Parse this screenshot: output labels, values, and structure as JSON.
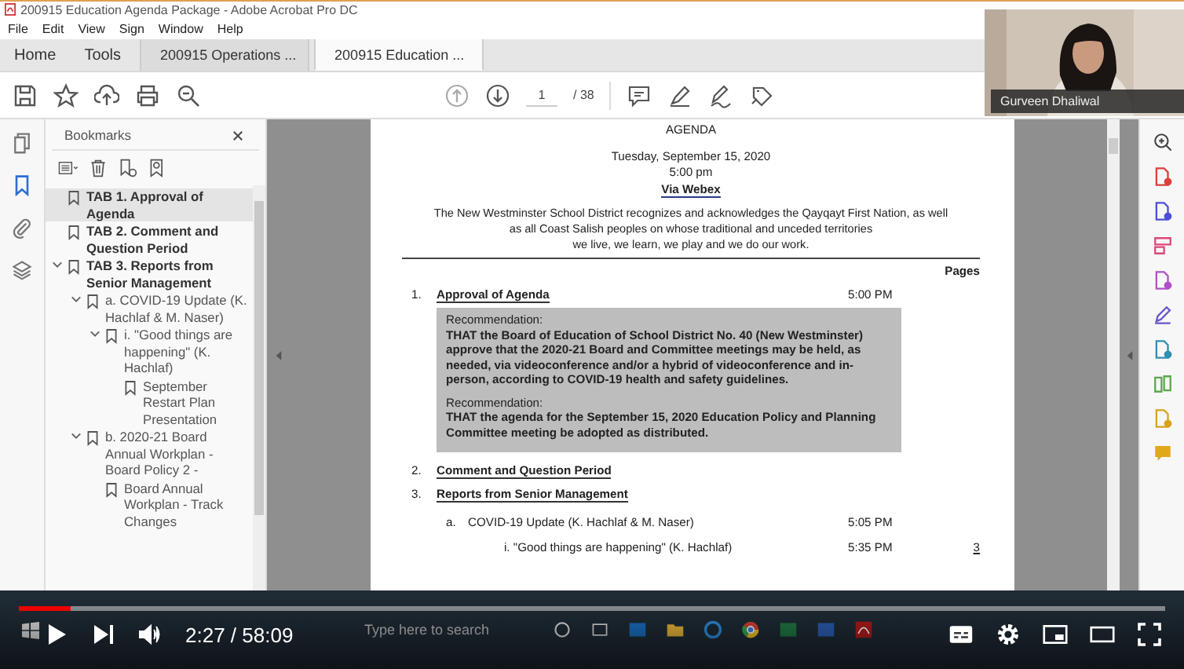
{
  "window": {
    "title": "200915 Education Agenda Package - Adobe Acrobat Pro DC"
  },
  "menu": [
    "File",
    "Edit",
    "View",
    "Sign",
    "Window",
    "Help"
  ],
  "nav_tabs": [
    {
      "label": "Home",
      "selected": false
    },
    {
      "label": "Tools",
      "selected": false
    }
  ],
  "doc_tabs": [
    {
      "label": "200915 Operations ...",
      "selected": false
    },
    {
      "label": "200915 Education ...",
      "selected": true
    }
  ],
  "page_nav": {
    "current": "1",
    "total": "/ 38"
  },
  "left_rail": [
    {
      "kind": "pages",
      "selected": false
    },
    {
      "kind": "bookmarks",
      "selected": true
    },
    {
      "kind": "attachments",
      "selected": false
    },
    {
      "kind": "layers",
      "selected": false
    }
  ],
  "bookmarks": {
    "title": "Bookmarks",
    "items": [
      {
        "label": "TAB 1. Approval of Agenda",
        "selected": true
      },
      {
        "label": "TAB 2. Comment and Question Period",
        "selected": false
      },
      {
        "label": "TAB 3. Reports from Senior Management",
        "selected": false,
        "expanded": true,
        "children": [
          {
            "label": "a. COVID-19 Update (K. Hachlaf & M. Naser)",
            "selected": false,
            "expanded": true,
            "children": [
              {
                "label": "i. \"Good things are happening\" (K. Hachlaf)",
                "selected": false,
                "expanded": true,
                "children": [
                  {
                    "label": "September Restart Plan Presentation",
                    "selected": false
                  }
                ]
              }
            ]
          },
          {
            "label": "b. 2020-21 Board Annual Workplan - Board Policy 2 -",
            "selected": false,
            "expanded": true,
            "children": [
              {
                "label": "Board Annual Workplan - Track Changes",
                "selected": false
              }
            ]
          }
        ]
      }
    ]
  },
  "document": {
    "heading": "AGENDA",
    "date": "Tuesday, September 15, 2020",
    "time": "5:00 pm",
    "venue": "Via Webex",
    "acknowledgement": [
      "The New Westminster School District recognizes and acknowledges the Qayqayt First Nation, as well",
      "as all Coast Salish peoples on whose traditional and unceded territories",
      "we live, we learn, we play and we do our work."
    ],
    "pages_label": "Pages",
    "items": [
      {
        "number": "1.",
        "title": "Approval of Agenda",
        "time": "5:00 PM",
        "recommendations": [
          {
            "label": "Recommendation:",
            "text": "THAT the Board of Education of School District No. 40 (New Westminster) approve that the 2020-21 Board and Committee meetings may be held, as needed, via videoconference and/or a hybrid of videoconference and in-person, according to COVID-19 health and safety guidelines."
          },
          {
            "label": "Recommendation:",
            "text": "THAT the agenda for the September 15, 2020 Education Policy and Planning Committee meeting be adopted as distributed."
          }
        ]
      },
      {
        "number": "2.",
        "title": "Comment and Question Period"
      },
      {
        "number": "3.",
        "title": "Reports from Senior Management",
        "subitems": [
          {
            "number": "a.",
            "title": "COVID-19 Update (K. Hachlaf & M. Naser)",
            "time": "5:05 PM",
            "subitems": [
              {
                "title": "i. \"Good things are happening\" (K. Hachlaf)",
                "time": "5:35 PM",
                "page": "3"
              }
            ]
          }
        ]
      }
    ]
  },
  "webcam": {
    "name": "Gurveen Dhaliwal"
  },
  "taskbar": {
    "search_placeholder": "Type here to search"
  },
  "video": {
    "progress": {
      "level": 0.045
    },
    "time": "2:27 / 58:09"
  }
}
